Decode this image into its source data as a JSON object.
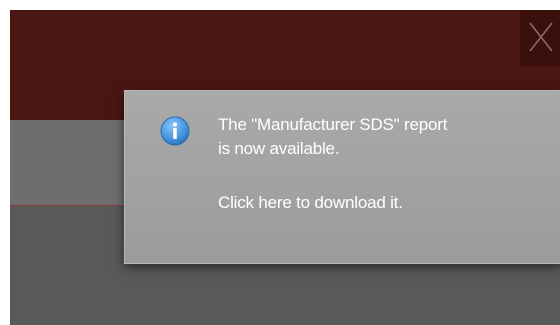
{
  "window": {
    "close_icon": "close-icon"
  },
  "notification": {
    "icon": "info-icon",
    "message_line1": "The \"Manufacturer SDS\" report",
    "message_line2": "is now available.",
    "action_text": "Click here to download it."
  },
  "colors": {
    "header": "#4a1612",
    "overlay": "#595959",
    "toast": "#a5a5a5",
    "info_icon": "#4f9be3",
    "text": "#ffffff"
  }
}
